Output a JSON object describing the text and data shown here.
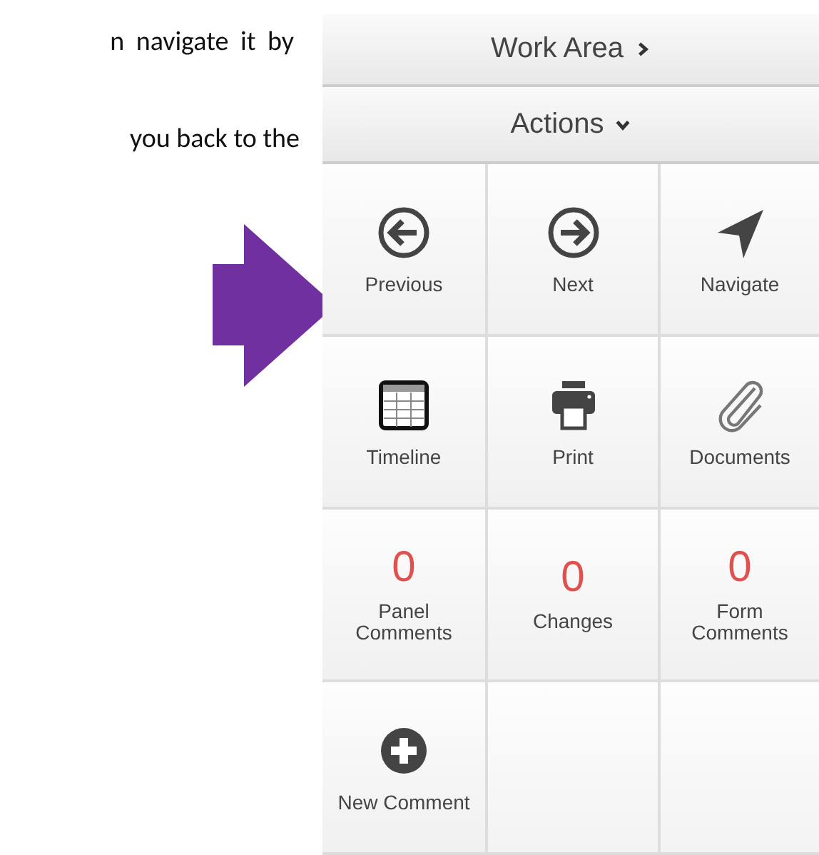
{
  "document": {
    "lines": [
      "n navigate it by",
      "you back to the"
    ]
  },
  "panel": {
    "header": {
      "label": "Work Area"
    },
    "actions": {
      "label": "Actions"
    },
    "cells": [
      {
        "kind": "icon",
        "label": "Previous"
      },
      {
        "kind": "icon",
        "label": "Next"
      },
      {
        "kind": "icon",
        "label": "Navigate"
      },
      {
        "kind": "icon",
        "label": "Timeline"
      },
      {
        "kind": "icon",
        "label": "Print"
      },
      {
        "kind": "icon",
        "label": "Documents"
      },
      {
        "kind": "count",
        "count": "0",
        "label": "Panel Comments"
      },
      {
        "kind": "count",
        "count": "0",
        "label": "Changes"
      },
      {
        "kind": "count",
        "count": "0",
        "label": "Form Comments"
      },
      {
        "kind": "icon",
        "label": "New Comment"
      },
      {
        "kind": "empty"
      },
      {
        "kind": "empty"
      }
    ]
  }
}
